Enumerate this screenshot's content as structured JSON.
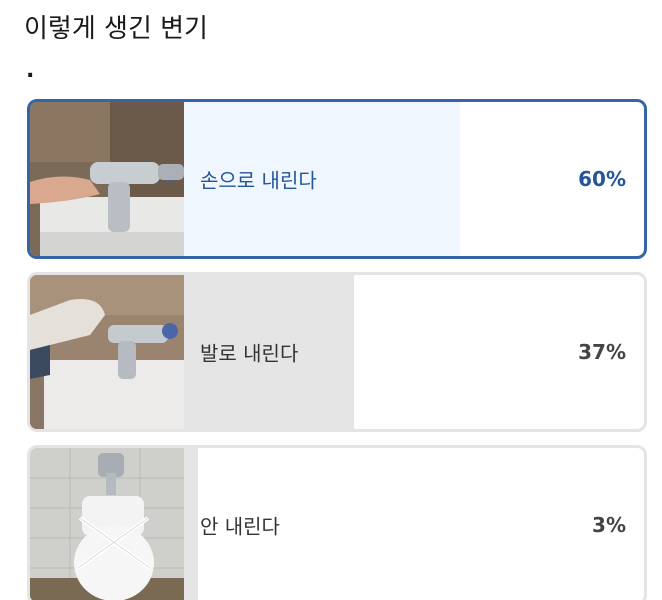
{
  "title": "이렇게 생긴 변기",
  "subtitle": ".",
  "options": [
    {
      "label": "손으로 내린다",
      "percent_text": "60%",
      "fraction": 0.6,
      "selected": true,
      "image": "hand-flushing-photo"
    },
    {
      "label": "발로 내린다",
      "percent_text": "37%",
      "fraction": 0.37,
      "selected": false,
      "image": "foot-flushing-photo"
    },
    {
      "label": "안 내린다",
      "percent_text": "3%",
      "fraction": 0.03,
      "selected": false,
      "image": "toilet-photo"
    }
  ],
  "colors": {
    "accent": "#3565a8",
    "selected_fill": "#f0f6fd",
    "unselected_fill": "#e5e5e5"
  }
}
